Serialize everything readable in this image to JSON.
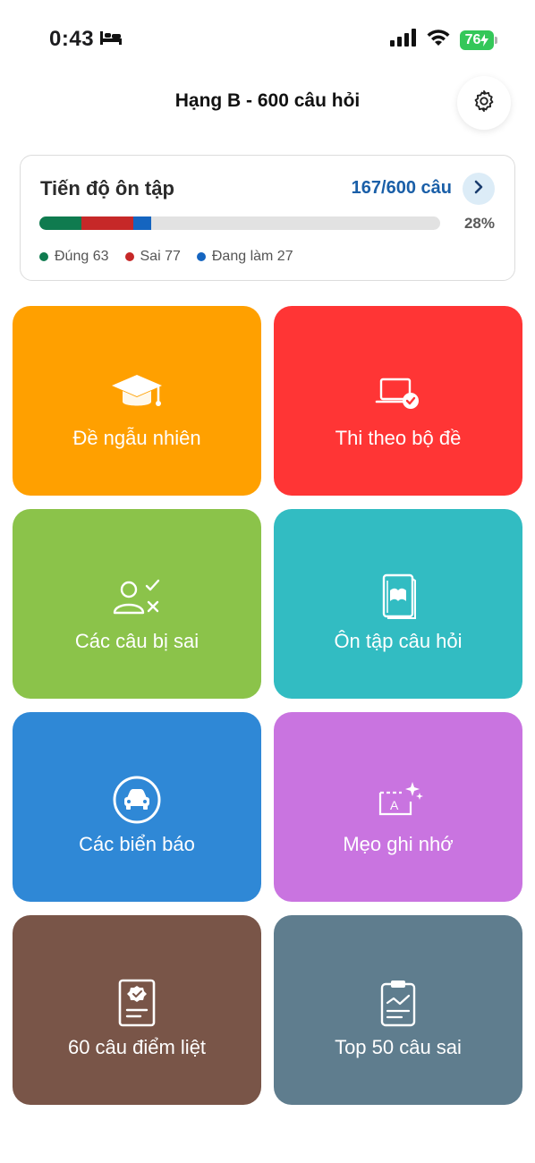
{
  "status_bar": {
    "time": "0:43",
    "battery": "76"
  },
  "header": {
    "title": "Hạng B - 600 câu hỏi"
  },
  "progress": {
    "title": "Tiến độ ôn tập",
    "count": "167/600 câu",
    "percent_text": "28%",
    "total": 600,
    "segments": [
      {
        "label": "Đúng 63",
        "value": 63,
        "color": "#0f7b4f"
      },
      {
        "label": "Sai 77",
        "value": 77,
        "color": "#c62828"
      },
      {
        "label": "Đang làm 27",
        "value": 27,
        "color": "#1565c0"
      }
    ]
  },
  "tiles": [
    {
      "label": "Đề ngẫu nhiên",
      "color": "#ffa000",
      "icon": "graduation-cap-icon"
    },
    {
      "label": "Thi theo bộ đề",
      "color": "#ff3535",
      "icon": "laptop-check-icon"
    },
    {
      "label": "Các câu bị sai",
      "color": "#8bc34a",
      "icon": "user-check-x-icon"
    },
    {
      "label": "Ôn tập câu hỏi",
      "color": "#32bcc2",
      "icon": "book-open-icon"
    },
    {
      "label": "Các biển báo",
      "color": "#2f88d6",
      "icon": "car-sign-icon"
    },
    {
      "label": "Mẹo ghi nhớ",
      "color": "#c974e0",
      "icon": "sparkle-card-icon"
    },
    {
      "label": "60 câu điểm liệt",
      "color": "#795548",
      "icon": "badge-document-icon"
    },
    {
      "label": "Top 50 câu sai",
      "color": "#5f7d8e",
      "icon": "clipboard-chart-icon"
    }
  ]
}
